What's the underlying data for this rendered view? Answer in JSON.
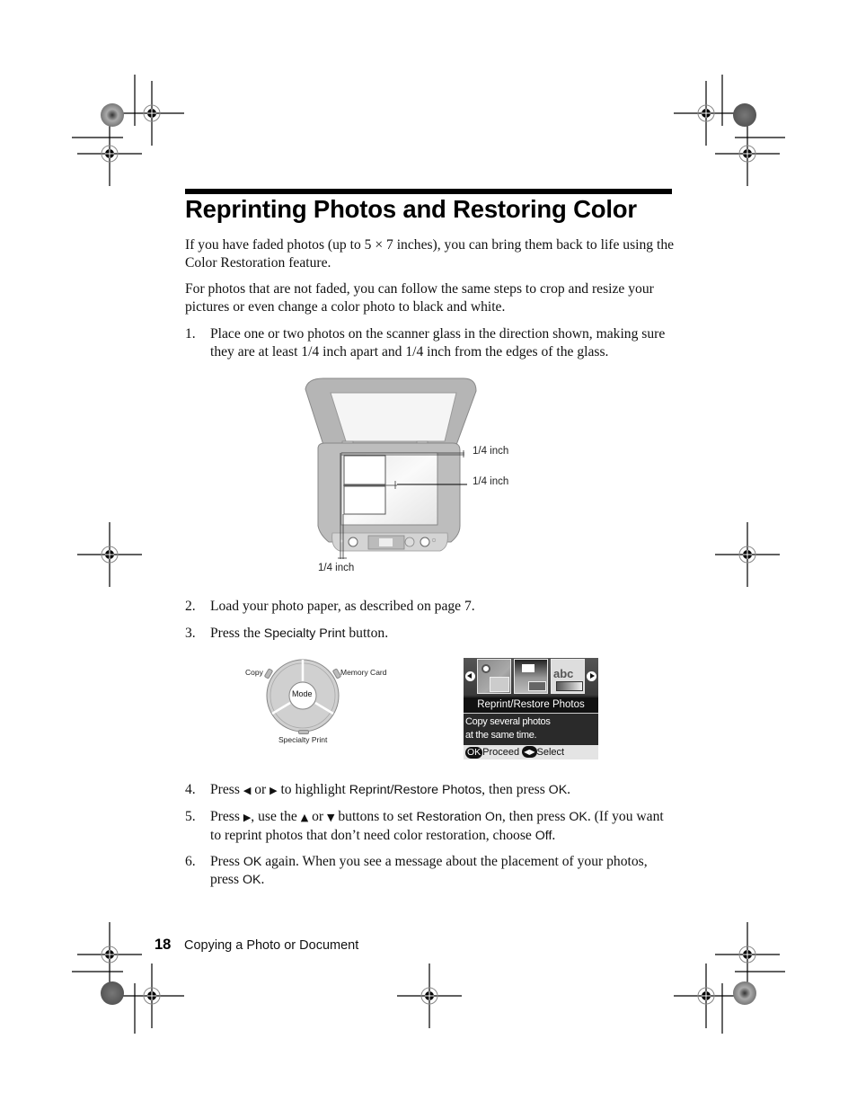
{
  "page": {
    "title": "Reprinting Photos and Restoring Color",
    "intro_paragraphs": [
      "If you have faded photos (up to 5 × 7 inches), you can bring them back to life using the Color Restoration feature.",
      "For photos that are not faded, you can follow the same steps to crop and resize your pictures or even change a color photo to black and white."
    ],
    "steps": [
      {
        "number": "1.",
        "text": "Place one or two photos on the scanner glass in the direction shown, making sure they are at least 1/4 inch apart and 1/4 inch from the edges of the glass."
      },
      {
        "number": "2.",
        "text": "Load your photo paper, as described on page 7."
      },
      {
        "number": "3.",
        "parts": {
          "before": "Press the ",
          "ui": "Specialty Print",
          "after": " button."
        }
      },
      {
        "number": "4.",
        "parts": {
          "p1": "Press ",
          "left_icon": "◀",
          "p2": " or ",
          "right_icon": "▶",
          "p3": " to highlight ",
          "ui1": "Reprint/Restore Photos",
          "p4": ", then press ",
          "ui2": "OK",
          "p5": "."
        }
      },
      {
        "number": "5.",
        "parts": {
          "p1": "Press ",
          "right_icon": "▶",
          "p2": ", use the ",
          "up_icon": "▲",
          "p3": " or ",
          "down_icon": "▼",
          "p4": " buttons to set ",
          "ui1": "Restoration On",
          "p5": ", then press ",
          "ui2": "OK",
          "p6": ". (If you want to reprint photos that don’t need color restoration, choose ",
          "ui3": "Off",
          "p7": "."
        }
      },
      {
        "number": "6.",
        "parts": {
          "p1": "Press ",
          "ui1": "OK",
          "p2": " again. When you see a message about the placement of your photos, press ",
          "ui2": "OK",
          "p3": "."
        }
      }
    ]
  },
  "scanner_figure": {
    "labels": {
      "top_margin": "1/4 inch",
      "gap": "1/4 inch",
      "left_margin": "1/4 inch"
    }
  },
  "mode_dial": {
    "center_label": "Mode",
    "copy_label": "Copy",
    "memory_card_label": "Memory Card",
    "specialty_print_label": "Specialty Print"
  },
  "lcd_screen": {
    "menu_title": "Reprint/Restore Photos",
    "description_line1": "Copy several photos",
    "description_line2": "at the same time.",
    "ok_label": "OK",
    "proceed_label": "Proceed",
    "select_label": "Select",
    "thumb_text": "abc"
  },
  "footer": {
    "page_number": "18",
    "section_title": "Copying a Photo or Document"
  }
}
